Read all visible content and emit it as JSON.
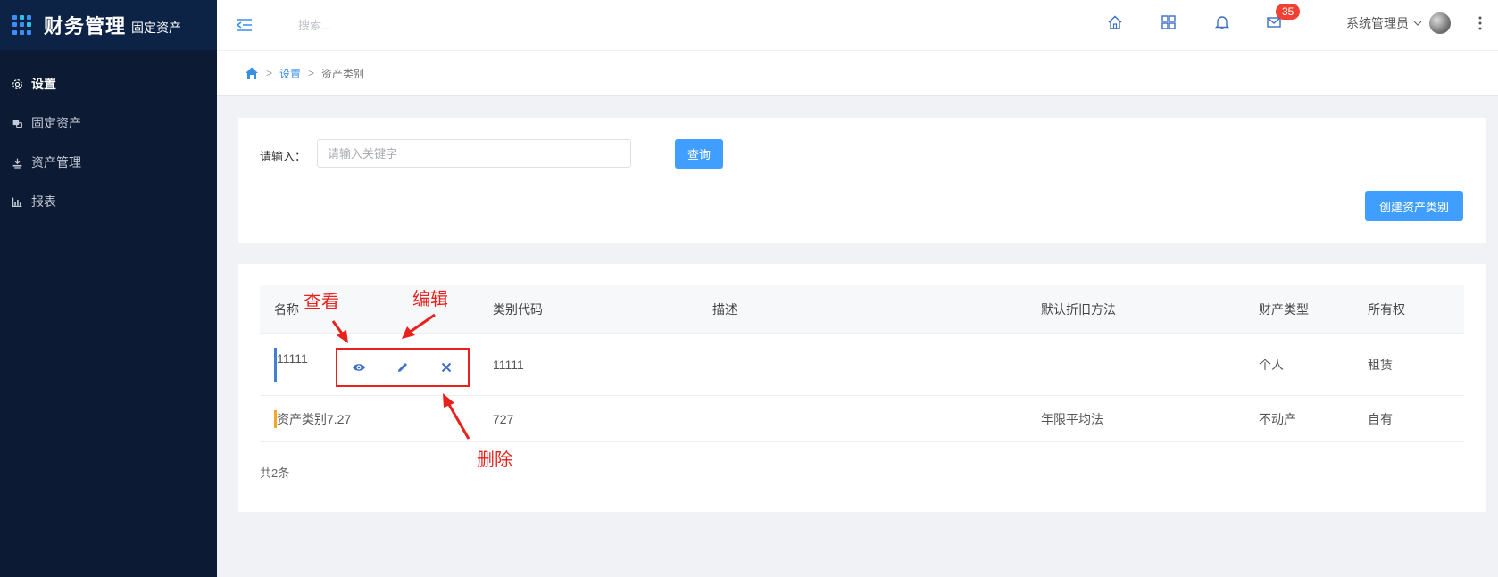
{
  "brand": {
    "name": "财务管理",
    "sub": "固定资产"
  },
  "sidebar": {
    "items": [
      {
        "label": "设置",
        "icon": "gear-icon",
        "active": true
      },
      {
        "label": "固定资产",
        "icon": "asset-icon",
        "active": false
      },
      {
        "label": "资产管理",
        "icon": "manage-icon",
        "active": false
      },
      {
        "label": "报表",
        "icon": "bar-chart-icon",
        "active": false
      }
    ]
  },
  "header": {
    "search_placeholder": "搜索...",
    "mail_badge": "35",
    "user_name": "系统管理员"
  },
  "breadcrumb": {
    "sep": ">",
    "parent": "设置",
    "current": "资产类别"
  },
  "query": {
    "label": "请输入：",
    "placeholder": "请输入关键字",
    "button": "查询",
    "create_button": "创建资产类别"
  },
  "table": {
    "columns": [
      "名称",
      "类别代码",
      "描述",
      "默认折旧方法",
      "财产类型",
      "所有权"
    ],
    "rows": [
      {
        "name": "11111",
        "code": "11111",
        "desc": "",
        "method": "",
        "type": "个人",
        "ownership": "租赁",
        "bar_color": "#3f7fd4"
      },
      {
        "name": "资产类别7.27",
        "code": "727",
        "desc": "",
        "method": "年限平均法",
        "type": "不动产",
        "ownership": "自有",
        "bar_color": "#f5a623"
      }
    ],
    "total": "共2条"
  },
  "annotations": {
    "view": "查看",
    "edit": "编辑",
    "delete": "删除"
  },
  "colors": {
    "sidebar": "#0c1a33",
    "primary": "#409eff",
    "annotation": "#e8211c"
  }
}
